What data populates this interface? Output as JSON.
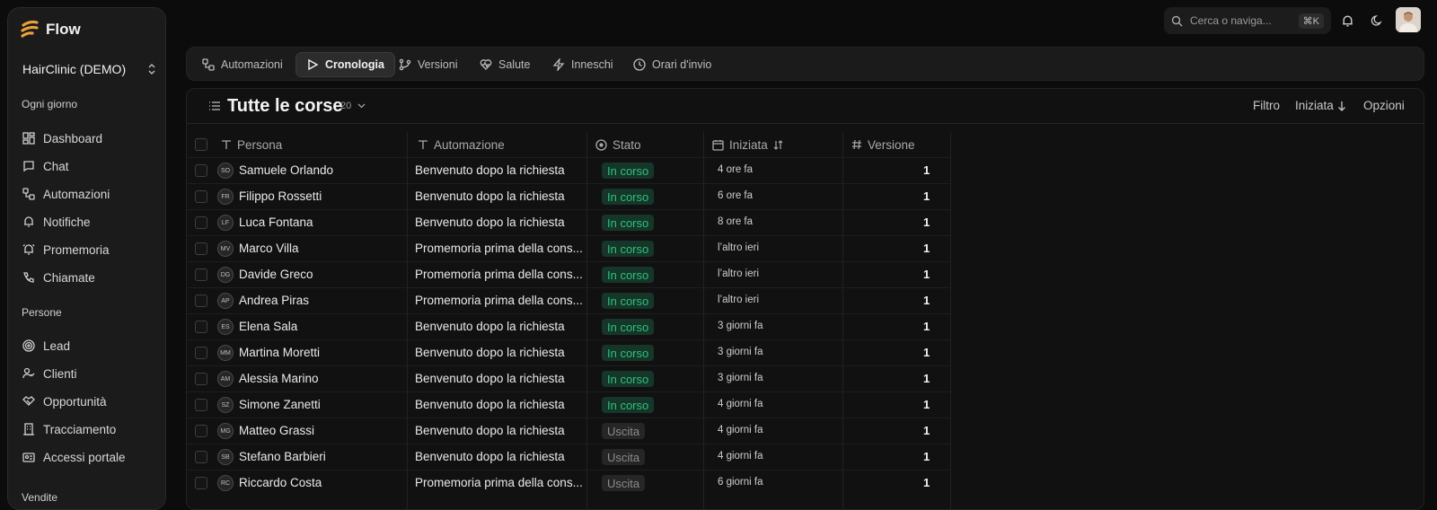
{
  "app": {
    "name": "Flow",
    "workspace": "HairClinic (DEMO)"
  },
  "sidebar": {
    "sections": [
      {
        "title": "Ogni giorno",
        "items": [
          "Dashboard",
          "Chat",
          "Automazioni",
          "Notifiche",
          "Promemoria",
          "Chiamate"
        ]
      },
      {
        "title": "Persone",
        "items": [
          "Lead",
          "Clienti",
          "Opportunità",
          "Tracciamento",
          "Accessi portale"
        ]
      },
      {
        "title": "Vendite",
        "items": []
      }
    ]
  },
  "topbar": {
    "search_placeholder": "Cerca o naviga...",
    "shortcut": "⌘K"
  },
  "tabs": [
    "Automazioni",
    "Cronologia",
    "Versioni",
    "Salute",
    "Inneschi",
    "Orari d'invio"
  ],
  "active_tab": "Cronologia",
  "table": {
    "title": "Tutte le corse",
    "count": "20",
    "actions": {
      "filter": "Filtro",
      "sort": "Iniziata",
      "options": "Opzioni"
    },
    "columns": [
      "Persona",
      "Automazione",
      "Stato",
      "Iniziata",
      "Versione"
    ],
    "rows": [
      {
        "initials": "SO",
        "persona": "Samuele Orlando",
        "automazione": "Benvenuto dopo la richiesta",
        "stato": "In corso",
        "iniziata": "4 ore fa",
        "versione": "1"
      },
      {
        "initials": "FR",
        "persona": "Filippo Rossetti",
        "automazione": "Benvenuto dopo la richiesta",
        "stato": "In corso",
        "iniziata": "6 ore fa",
        "versione": "1"
      },
      {
        "initials": "LF",
        "persona": "Luca Fontana",
        "automazione": "Benvenuto dopo la richiesta",
        "stato": "In corso",
        "iniziata": "8 ore fa",
        "versione": "1"
      },
      {
        "initials": "MV",
        "persona": "Marco Villa",
        "automazione": "Promemoria prima della cons...",
        "stato": "In corso",
        "iniziata": "l’altro ieri",
        "versione": "1"
      },
      {
        "initials": "DG",
        "persona": "Davide Greco",
        "automazione": "Promemoria prima della cons...",
        "stato": "In corso",
        "iniziata": "l’altro ieri",
        "versione": "1"
      },
      {
        "initials": "AP",
        "persona": "Andrea Piras",
        "automazione": "Promemoria prima della cons...",
        "stato": "In corso",
        "iniziata": "l’altro ieri",
        "versione": "1"
      },
      {
        "initials": "ES",
        "persona": "Elena Sala",
        "automazione": "Benvenuto dopo la richiesta",
        "stato": "In corso",
        "iniziata": "3 giorni fa",
        "versione": "1"
      },
      {
        "initials": "MM",
        "persona": "Martina Moretti",
        "automazione": "Benvenuto dopo la richiesta",
        "stato": "In corso",
        "iniziata": "3 giorni fa",
        "versione": "1"
      },
      {
        "initials": "AM",
        "persona": "Alessia Marino",
        "automazione": "Benvenuto dopo la richiesta",
        "stato": "In corso",
        "iniziata": "3 giorni fa",
        "versione": "1"
      },
      {
        "initials": "SZ",
        "persona": "Simone Zanetti",
        "automazione": "Benvenuto dopo la richiesta",
        "stato": "In corso",
        "iniziata": "4 giorni fa",
        "versione": "1"
      },
      {
        "initials": "MG",
        "persona": "Matteo Grassi",
        "automazione": "Benvenuto dopo la richiesta",
        "stato": "Uscita",
        "iniziata": "4 giorni fa",
        "versione": "1"
      },
      {
        "initials": "SB",
        "persona": "Stefano Barbieri",
        "automazione": "Benvenuto dopo la richiesta",
        "stato": "Uscita",
        "iniziata": "4 giorni fa",
        "versione": "1"
      },
      {
        "initials": "RC",
        "persona": "Riccardo Costa",
        "automazione": "Promemoria prima della cons...",
        "stato": "Uscita",
        "iniziata": "6 giorni fa",
        "versione": "1"
      }
    ]
  },
  "colors": {
    "running": "#2ec27e",
    "exited": "#8a8a8a",
    "brand": "#e9a23b"
  }
}
